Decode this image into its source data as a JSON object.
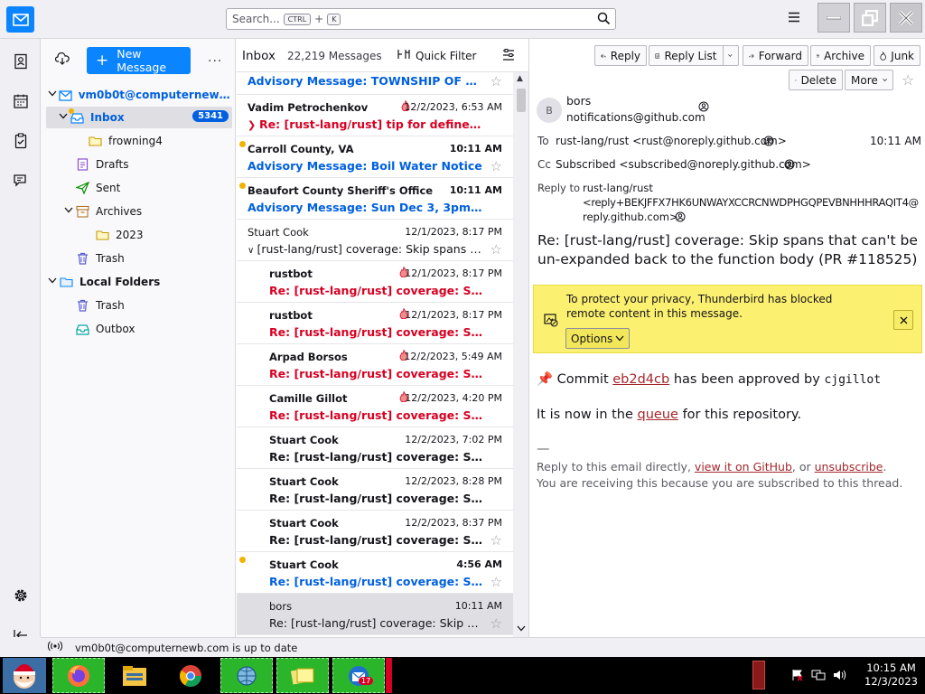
{
  "toolbar": {
    "search_placeholder": "Search...",
    "search_key1": "CTRL",
    "search_plus": "+",
    "search_key2": "K"
  },
  "folder_pane": {
    "new_message": "New Message",
    "more": "...",
    "account": "vm0b0t@computernewb...",
    "inbox": "Inbox",
    "inbox_unread": "5341",
    "folders": [
      "frowning4",
      "Drafts",
      "Sent",
      "Archives",
      "2023",
      "Trash"
    ],
    "local_folders": "Local Folders",
    "local_items": [
      "Trash",
      "Outbox"
    ]
  },
  "thread_pane": {
    "title": "Inbox",
    "count": "22,219 Messages",
    "quick_filter": "Quick Filter",
    "rows": [
      {
        "from": "",
        "date": "",
        "subject": "Advisory Message: TOWNSHIP OF TEA..."
      },
      {
        "from": "Vadim Petrochenkov",
        "date": "12/2/2023, 6:53 AM",
        "subject": "Re: [rust-lang/rust] tip for define macro ..."
      },
      {
        "from": "Carroll County, VA",
        "date": "10:11 AM",
        "subject": "Advisory Message: Boil Water Notice"
      },
      {
        "from": "Beaufort County Sheriff's Office",
        "date": "10:11 AM",
        "subject": "Advisory Message: Sun Dec 3, 3pm to 5..."
      },
      {
        "from": "Stuart Cook",
        "date": "12/1/2023, 8:17 PM",
        "subject": "[rust-lang/rust] coverage: Skip spans tha..."
      },
      {
        "from": "rustbot",
        "date": "12/1/2023, 8:17 PM",
        "subject": "Re: [rust-lang/rust] coverage: Skip span..."
      },
      {
        "from": "rustbot",
        "date": "12/1/2023, 8:17 PM",
        "subject": "Re: [rust-lang/rust] coverage: Skip span..."
      },
      {
        "from": "Arpad Borsos",
        "date": "12/2/2023, 5:49 AM",
        "subject": "Re: [rust-lang/rust] coverage: Skip span..."
      },
      {
        "from": "Camille Gillot",
        "date": "12/2/2023, 4:20 PM",
        "subject": "Re: [rust-lang/rust] coverage: Skip span..."
      },
      {
        "from": "Stuart Cook",
        "date": "12/2/2023, 7:02 PM",
        "subject": "Re: [rust-lang/rust] coverage: Skip s..."
      },
      {
        "from": "Stuart Cook",
        "date": "12/2/2023, 8:28 PM",
        "subject": "Re: [rust-lang/rust] coverage: Skip s..."
      },
      {
        "from": "Stuart Cook",
        "date": "12/2/2023, 8:37 PM",
        "subject": "Re: [rust-lang/rust] coverage: Skip s..."
      },
      {
        "from": "Stuart Cook",
        "date": "4:56 AM",
        "subject": "Re: [rust-lang/rust] coverage: Skip s..."
      },
      {
        "from": "bors",
        "date": "10:11 AM",
        "subject": "Re: [rust-lang/rust] coverage: Skip spa..."
      }
    ]
  },
  "message": {
    "buttons": {
      "reply": "Reply",
      "reply_list": "Reply List",
      "forward": "Forward",
      "archive": "Archive",
      "junk": "Junk",
      "delete": "Delete",
      "more": "More"
    },
    "avatar": "B",
    "from_name": "bors",
    "from_email": "notifications@github.com",
    "to_label": "To",
    "to": "rust-lang/rust <rust@noreply.github.com>",
    "time": "10:11 AM",
    "cc_label": "Cc",
    "cc": "Subscribed <subscribed@noreply.github.com>",
    "replyto_label": "Reply to",
    "replyto_1": "rust-lang/rust",
    "replyto_2": "<reply+BEKJFFX7HK6UNWAYXCCRCNWDPHGQPEVBNHHHRAQIT4@",
    "replyto_3": "reply.github.com>",
    "subject": "Re: [rust-lang/rust] coverage: Skip spans that can't be un-expanded back to the function body (PR #118525)",
    "notice_text": "To protect your privacy, Thunderbird has blocked remote content in this message.",
    "notice_options": "Options",
    "body": {
      "commit_prefix": "Commit",
      "commit_hash": "eb2d4cb",
      "commit_mid": "has been approved by",
      "approver": "cjgillot",
      "queue_prefix": "It is now in the",
      "queue_link": "queue",
      "queue_suffix": "for this repository.",
      "dash": "—",
      "foot_1": "Reply to this email directly,",
      "foot_link1": "view it on GitHub",
      "foot_or": ", or",
      "foot_link2": "unsubscribe",
      "foot_end": ".",
      "foot_2": "You are receiving this because you are subscribed to this thread."
    }
  },
  "status": {
    "text": "vm0b0t@computernewb.com is up to date"
  },
  "taskbar": {
    "time": "10:15 AM",
    "date": "12/3/2023",
    "mail_badge": "17"
  },
  "colors": {
    "accent": "#0a84ff",
    "unread_blue": "#0060df",
    "junk_red": "#d70022",
    "notice_yellow": "#fbf070"
  }
}
